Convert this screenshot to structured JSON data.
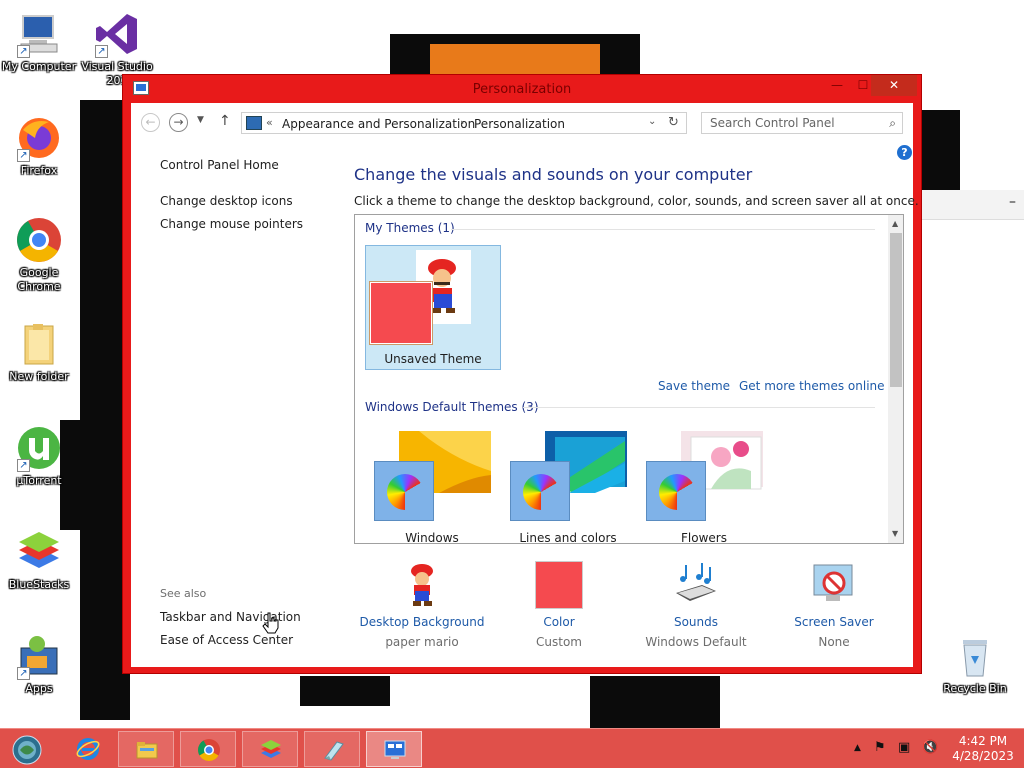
{
  "desktop": {
    "icons": [
      {
        "label": "My Computer"
      },
      {
        "label": "Visual Studio 201"
      },
      {
        "label": "Firefox"
      },
      {
        "label": "Google Chrome"
      },
      {
        "label": "New folder"
      },
      {
        "label": "µTorrent"
      },
      {
        "label": "BlueStacks"
      },
      {
        "label": "Apps"
      },
      {
        "label": "Recycle Bin"
      }
    ]
  },
  "window": {
    "title": "Personalization",
    "caption": {
      "minimize": "—",
      "maximize": "☐",
      "close": "✕"
    },
    "address": {
      "overflow": "«",
      "crumbs": [
        "Appearance and Personalization",
        "Personalization"
      ],
      "separator": "›"
    },
    "search": {
      "placeholder": "Search Control Panel"
    },
    "left_pane": {
      "home": "Control Panel Home",
      "links": [
        "Change desktop icons",
        "Change mouse pointers"
      ],
      "see_also_title": "See also",
      "see_also": [
        "Taskbar and Navigation",
        "Ease of Access Center"
      ]
    },
    "heading": "Change the visuals and sounds on your computer",
    "description": "Click a theme to change the desktop background, color, sounds, and screen saver all at once.",
    "my_themes": {
      "header": "My Themes (1)",
      "themes": [
        {
          "name": "Unsaved Theme",
          "color": "#f54a4f"
        }
      ],
      "save_link": "Save theme",
      "online_link": "Get more themes online"
    },
    "default_themes": {
      "header": "Windows Default Themes (3)",
      "themes": [
        {
          "name": "Windows"
        },
        {
          "name": "Lines and colors"
        },
        {
          "name": "Flowers"
        }
      ]
    },
    "settings": [
      {
        "label": "Desktop Background",
        "value": "paper mario",
        "icon": "mario-icon"
      },
      {
        "label": "Color",
        "value": "Custom",
        "icon": "color-swatch-icon",
        "color": "#f54a4f"
      },
      {
        "label": "Sounds",
        "value": "Windows Default",
        "icon": "sounds-icon"
      },
      {
        "label": "Screen Saver",
        "value": "None",
        "icon": "screen-saver-icon"
      }
    ],
    "frame_color": "#e81a1a"
  },
  "taskbar": {
    "color": "#e0504a",
    "clock": {
      "time": "4:42 PM",
      "date": "4/28/2023"
    }
  }
}
